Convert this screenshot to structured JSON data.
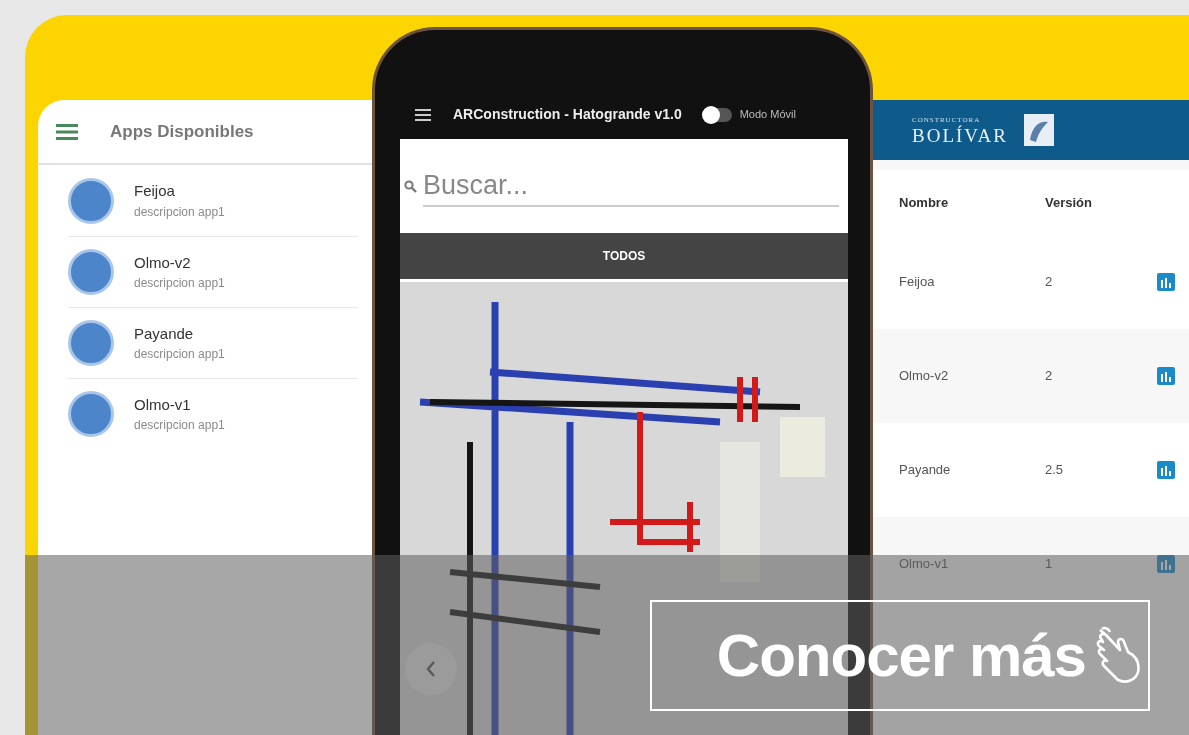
{
  "left_panel": {
    "title": "Apps Disponibles",
    "apps": [
      {
        "name": "Feijoa",
        "description": "descripcion app1"
      },
      {
        "name": "Olmo-v2",
        "description": "descripcion app1"
      },
      {
        "name": "Payande",
        "description": "descripcion app1"
      },
      {
        "name": "Olmo-v1",
        "description": "descripcion app1"
      }
    ]
  },
  "phone": {
    "title": "ARConstruction - Hatogrande v1.0",
    "toggle": {
      "label": "Modo Móvil",
      "on": false
    },
    "search": {
      "placeholder": "Buscar..."
    },
    "tabs": [
      {
        "label": "TODOS",
        "selected": true
      }
    ]
  },
  "right_panel": {
    "brand_small": "CONSTRUCTORA",
    "brand": "BOLÍVAR",
    "columns": [
      "Nombre",
      "Versión"
    ],
    "rows": [
      {
        "name": "Feijoa",
        "version": "2"
      },
      {
        "name": "Olmo-v2",
        "version": "2"
      },
      {
        "name": "Payande",
        "version": "2.5"
      },
      {
        "name": "Olmo-v1",
        "version": "1"
      }
    ]
  },
  "cta": {
    "label": "Conocer más"
  }
}
